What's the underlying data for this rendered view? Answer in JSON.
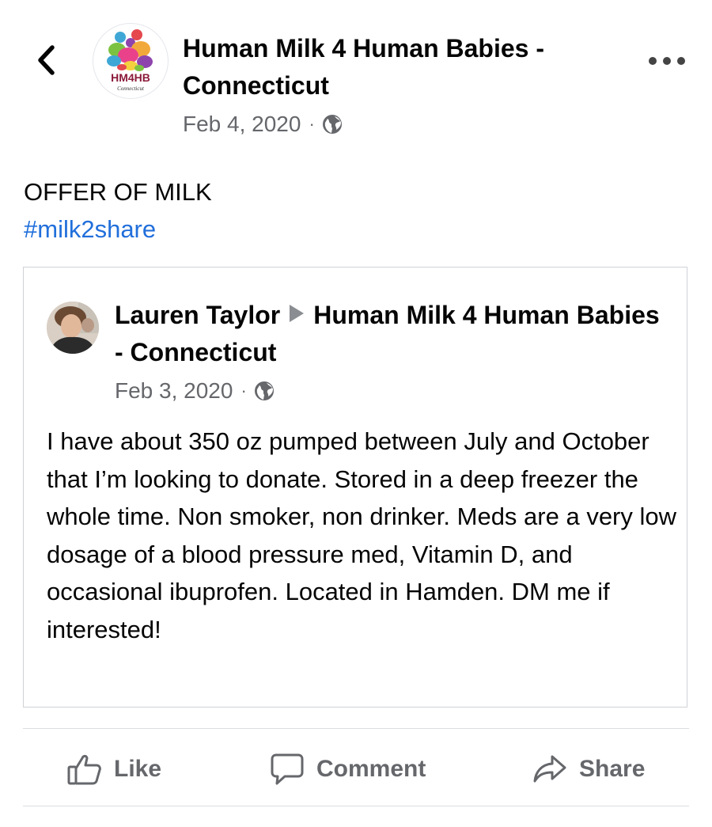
{
  "header": {
    "group_name": "Human Milk 4 Human Babies - Connecticut",
    "date": "Feb 4, 2020",
    "separator": "·",
    "logo_text": "HM4HB",
    "logo_subtext": "Connecticut"
  },
  "post": {
    "line1": "OFFER OF MILK",
    "hashtag": "#milk2share"
  },
  "shared_post": {
    "author": "Lauren Taylor",
    "group": "Human Milk 4 Human Babies - Connecticut",
    "date": "Feb 3, 2020",
    "separator": "·",
    "body": "I have about 350 oz pumped between July and October that I’m looking to donate. Stored in a deep freezer the whole time. Non smoker, non drinker. Meds are a very low dosage of a blood pressure med, Vitamin D, and occasional ibuprofen. Located in Hamden. DM me if interested!"
  },
  "actions": {
    "like": "Like",
    "comment": "Comment",
    "share": "Share"
  },
  "colors": {
    "hashtag": "#216fdb",
    "secondary_text": "#65676b",
    "divider": "#dadde1"
  },
  "icons": [
    "chevron-left-icon",
    "more-icon",
    "globe-icon",
    "like-icon",
    "comment-icon",
    "share-icon"
  ]
}
